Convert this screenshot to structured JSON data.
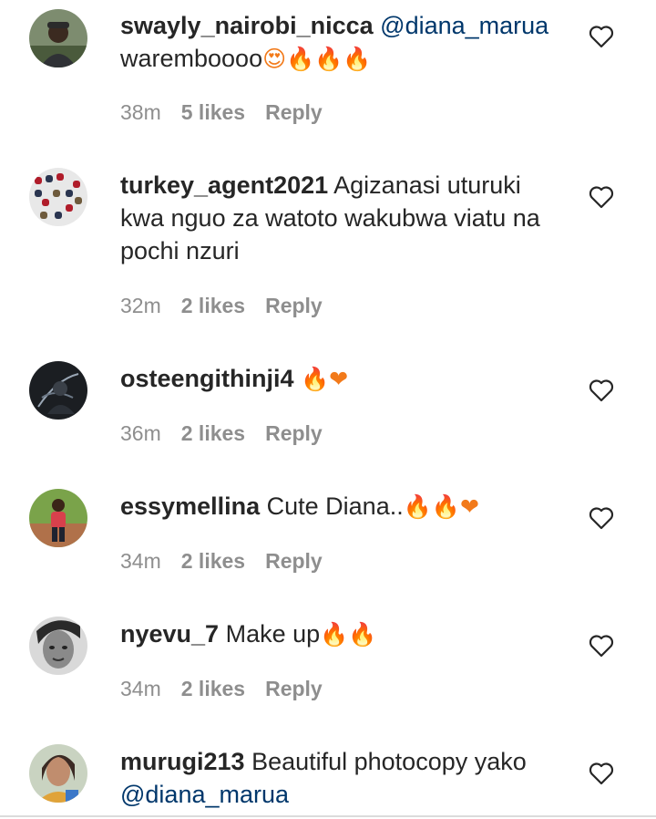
{
  "comments": [
    {
      "username": "swayly_nairobi_nicca",
      "mention": "@diana_marua",
      "text": "waremboooo",
      "emojis": "😍🔥🔥🔥",
      "time": "38m",
      "likes": "5 likes",
      "reply": "Reply"
    },
    {
      "username": "turkey_agent2021",
      "text": "Agizanasi uturuki kwa nguo za watoto wakubwa viatu na pochi nzuri",
      "time": "32m",
      "likes": "2 likes",
      "reply": "Reply"
    },
    {
      "username": "osteengithinji4",
      "emojis": "🔥❤",
      "time": "36m",
      "likes": "2 likes",
      "reply": "Reply"
    },
    {
      "username": "essymellina",
      "text": "Cute Diana..",
      "emojis": "🔥🔥❤",
      "time": "34m",
      "likes": "2 likes",
      "reply": "Reply"
    },
    {
      "username": "nyevu_7",
      "text": "Make up",
      "emojis": "🔥🔥",
      "time": "34m",
      "likes": "2 likes",
      "reply": "Reply"
    },
    {
      "username": "murugi213",
      "text": "Beautiful photocopy yako",
      "mention": "@diana_marua"
    }
  ],
  "icons": {
    "like": "heart-outline-icon",
    "avatar": "user-avatar"
  },
  "colors": {
    "text": "#262626",
    "muted": "#8e8e8e",
    "mention": "#00376b",
    "fire": "#f27a1a",
    "heart": "#e0182d"
  }
}
